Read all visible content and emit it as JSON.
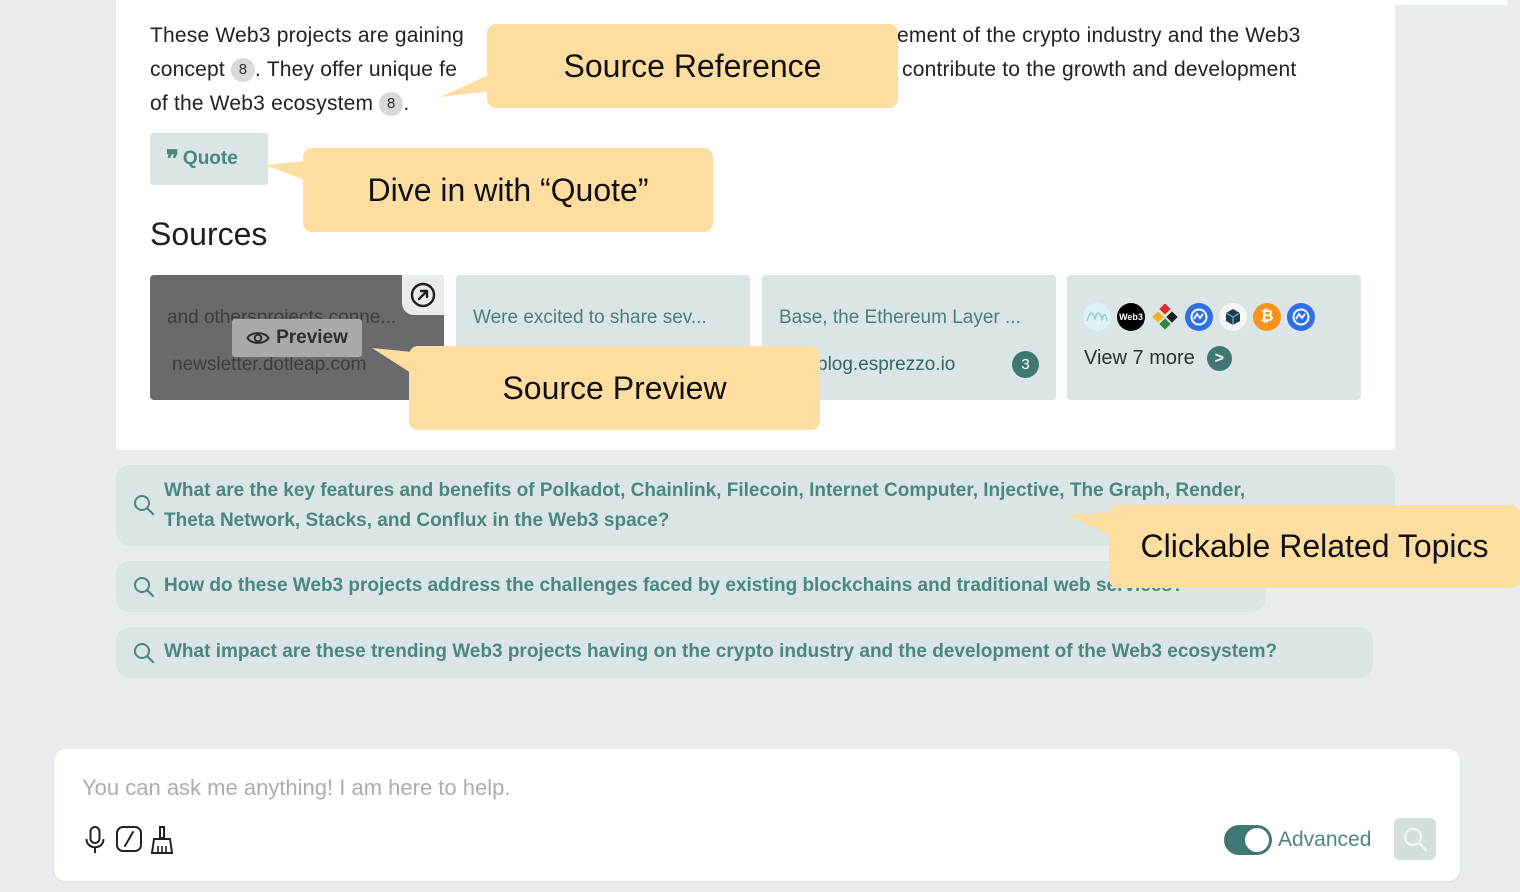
{
  "answer": {
    "line1_start": "These Web3 projects are gaining",
    "line1_end": "ement of the crypto industry and the Web3",
    "line2_start": "concept",
    "line2_mid": ". They offer unique fe",
    "line2_end": "contribute to the growth and development",
    "line3_start": "of the Web3 ecosystem",
    "line3_end": ".",
    "citation": "8"
  },
  "quote_button": {
    "label": "Quote",
    "icon": "quote-icon"
  },
  "sources": {
    "title": "Sources",
    "cards": [
      {
        "snippet": "and othersprojects conne...",
        "domain": "newsletter.dotleap.com",
        "preview_label": "Preview",
        "icons": [
          "external-link-icon",
          "eye-icon"
        ]
      },
      {
        "snippet": "Were excited to share sev..."
      },
      {
        "snippet": "Base, the Ethereum Layer ...",
        "domain": "blog.esprezzo.io",
        "count": "3"
      }
    ],
    "more": {
      "label": "View 7 more",
      "arrow": ">",
      "logos": [
        {
          "name": "waves-logo",
          "text": ""
        },
        {
          "name": "web3-logo",
          "text": "Web3"
        },
        {
          "name": "colorful-diamond-logo",
          "text": ""
        },
        {
          "name": "coinmarketcap-logo",
          "text": ""
        },
        {
          "name": "cube-logo",
          "text": ""
        },
        {
          "name": "bitcoin-logo",
          "text": "₿"
        },
        {
          "name": "coinmarketcap-logo-2",
          "text": ""
        }
      ]
    }
  },
  "related": [
    {
      "line1": "What are the key features and benefits of Polkadot, Chainlink, Filecoin, Internet Computer, Injective, The Graph, Render,",
      "line2": "Theta Network, Stacks, and Conflux in the Web3 space?"
    },
    {
      "line1": "How do these Web3 projects address the challenges faced by existing blockchains and traditional web services?"
    },
    {
      "line1": "What impact are these trending Web3 projects having on the crypto industry and the development of the Web3 ecosystem?"
    }
  ],
  "callouts": {
    "source_reference": "Source Reference",
    "quote": "Dive in with “Quote”",
    "source_preview": "Source Preview",
    "related_topics": "Clickable Related Topics"
  },
  "input_bar": {
    "placeholder": "You can ask me anything! I am here to help.",
    "tools": [
      "microphone-icon",
      "slash-command-icon",
      "broom-clear-icon"
    ],
    "advanced_label": "Advanced",
    "advanced_on": true
  },
  "colors": {
    "accent": "#3f7872",
    "accent_text": "#4a8780",
    "card_bg": "#dbe5e5",
    "callout_bg": "#fedda1",
    "page_bg": "#eaedf0"
  }
}
